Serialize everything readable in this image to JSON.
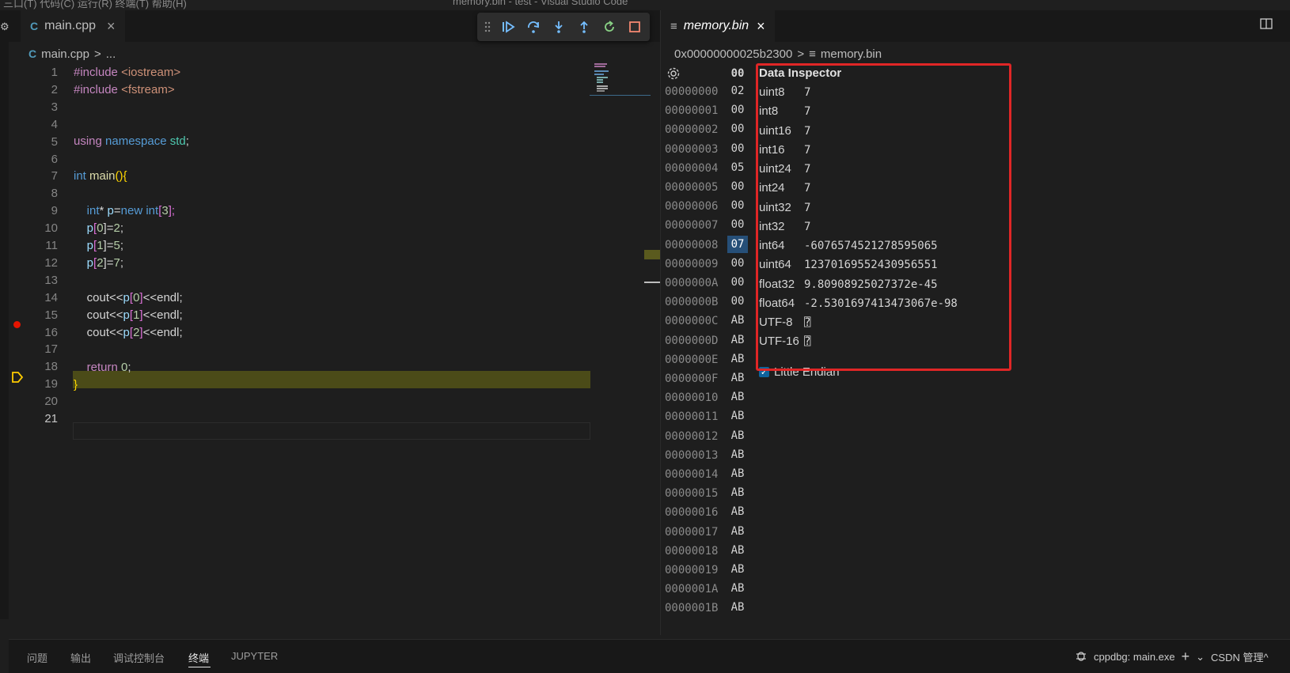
{
  "titlebar": {
    "menu": "三口(T)  代码(C)  运行(R)  终端(T)  帮助(H)",
    "title": "memory.bin - test - Visual Studio Code"
  },
  "left_editor": {
    "tab": {
      "label": "main.cpp",
      "close": "×"
    },
    "breadcrumb": {
      "file": "main.cpp",
      "sep": ">",
      "rest": "..."
    },
    "lines": [
      {
        "n": "1"
      },
      {
        "n": "2"
      },
      {
        "n": "3"
      },
      {
        "n": "4"
      },
      {
        "n": "5"
      },
      {
        "n": "6"
      },
      {
        "n": "7"
      },
      {
        "n": "8"
      },
      {
        "n": "9"
      },
      {
        "n": "10"
      },
      {
        "n": "11"
      },
      {
        "n": "12"
      },
      {
        "n": "13"
      },
      {
        "n": "14"
      },
      {
        "n": "15"
      },
      {
        "n": "16"
      },
      {
        "n": "17"
      },
      {
        "n": "18"
      },
      {
        "n": "19"
      },
      {
        "n": "20"
      },
      {
        "n": "21"
      }
    ],
    "code": {
      "l1": [
        "#include",
        "<iostream>"
      ],
      "l2": [
        "#include",
        "<fstream>"
      ],
      "l5": [
        "using",
        "namespace",
        "std",
        ";"
      ],
      "l7": [
        "int",
        "main",
        "(){"
      ],
      "l9": [
        "int",
        "* ",
        "p",
        "=",
        "new",
        "int",
        "[",
        "3",
        "];"
      ],
      "l10": [
        "p",
        "[",
        "0",
        "]=",
        "2",
        ";"
      ],
      "l11": [
        "p",
        "[",
        "1",
        "]=",
        "5",
        ";"
      ],
      "l12": [
        "p",
        "[",
        "2",
        "]=",
        "7",
        ";"
      ],
      "l14": [
        "cout<<",
        "p",
        "[",
        "0",
        "]",
        "<<endl;"
      ],
      "l15": [
        "cout<<",
        "p",
        "[",
        "1",
        "]",
        "<<endl;"
      ],
      "l16": [
        "cout<<",
        "p",
        "[",
        "2",
        "]",
        "<<endl;"
      ],
      "l18": [
        "return",
        "0",
        ";"
      ],
      "l19": [
        "}"
      ]
    }
  },
  "debug_toolbar": {
    "buttons": [
      "drag-handle",
      "continue",
      "step-over",
      "step-into",
      "step-out",
      "restart",
      "stop"
    ]
  },
  "right_editor": {
    "tab": {
      "label": "memory.bin",
      "close": "×"
    },
    "breadcrumb": {
      "address": "0x00000000025b2300",
      "sep": ">",
      "file": "memory.bin"
    },
    "hex_header": "00",
    "rows": [
      {
        "addr": "00000000",
        "byte": "02"
      },
      {
        "addr": "00000001",
        "byte": "00"
      },
      {
        "addr": "00000002",
        "byte": "00"
      },
      {
        "addr": "00000003",
        "byte": "00"
      },
      {
        "addr": "00000004",
        "byte": "05"
      },
      {
        "addr": "00000005",
        "byte": "00"
      },
      {
        "addr": "00000006",
        "byte": "00"
      },
      {
        "addr": "00000007",
        "byte": "00"
      },
      {
        "addr": "00000008",
        "byte": "07"
      },
      {
        "addr": "00000009",
        "byte": "00"
      },
      {
        "addr": "0000000A",
        "byte": "00"
      },
      {
        "addr": "0000000B",
        "byte": "00"
      },
      {
        "addr": "0000000C",
        "byte": "AB"
      },
      {
        "addr": "0000000D",
        "byte": "AB"
      },
      {
        "addr": "0000000E",
        "byte": "AB"
      },
      {
        "addr": "0000000F",
        "byte": "AB"
      },
      {
        "addr": "00000010",
        "byte": "AB"
      },
      {
        "addr": "00000011",
        "byte": "AB"
      },
      {
        "addr": "00000012",
        "byte": "AB"
      },
      {
        "addr": "00000013",
        "byte": "AB"
      },
      {
        "addr": "00000014",
        "byte": "AB"
      },
      {
        "addr": "00000015",
        "byte": "AB"
      },
      {
        "addr": "00000016",
        "byte": "AB"
      },
      {
        "addr": "00000017",
        "byte": "AB"
      },
      {
        "addr": "00000018",
        "byte": "AB"
      },
      {
        "addr": "00000019",
        "byte": "AB"
      },
      {
        "addr": "0000001A",
        "byte": "AB"
      },
      {
        "addr": "0000001B",
        "byte": "AB"
      }
    ],
    "selected_index": 8
  },
  "data_inspector": {
    "title": "Data Inspector",
    "rows": [
      {
        "k": "uint8",
        "v": "7"
      },
      {
        "k": "int8",
        "v": "7"
      },
      {
        "k": "uint16",
        "v": "7"
      },
      {
        "k": "int16",
        "v": "7"
      },
      {
        "k": "uint24",
        "v": "7"
      },
      {
        "k": "int24",
        "v": "7"
      },
      {
        "k": "uint32",
        "v": "7"
      },
      {
        "k": "int32",
        "v": "7"
      },
      {
        "k": "int64",
        "v": "-6076574521278595065"
      },
      {
        "k": "uint64",
        "v": "12370169552430956551"
      },
      {
        "k": "float32",
        "v": "9.80908925027372e-45"
      },
      {
        "k": "float64",
        "v": "-2.5301697413473067e-98"
      },
      {
        "k": "UTF-8",
        "v": "⍰"
      },
      {
        "k": "UTF-16",
        "v": "⍰"
      }
    ],
    "endian_label": "Little Endian",
    "endian_checked": true
  },
  "panel": {
    "tabs": [
      "问题",
      "输出",
      "调试控制台",
      "终端",
      "JUPYTER"
    ],
    "active_tab": "终端",
    "terminal_name": "cppdbg: main.exe",
    "add": "+",
    "right_misc": "CSDN 管理^"
  },
  "colors": {
    "accent": "#0e639c",
    "breakpoint": "#e51400",
    "highlight_line": "#4b4b18",
    "annotation_box": "#e02626"
  }
}
